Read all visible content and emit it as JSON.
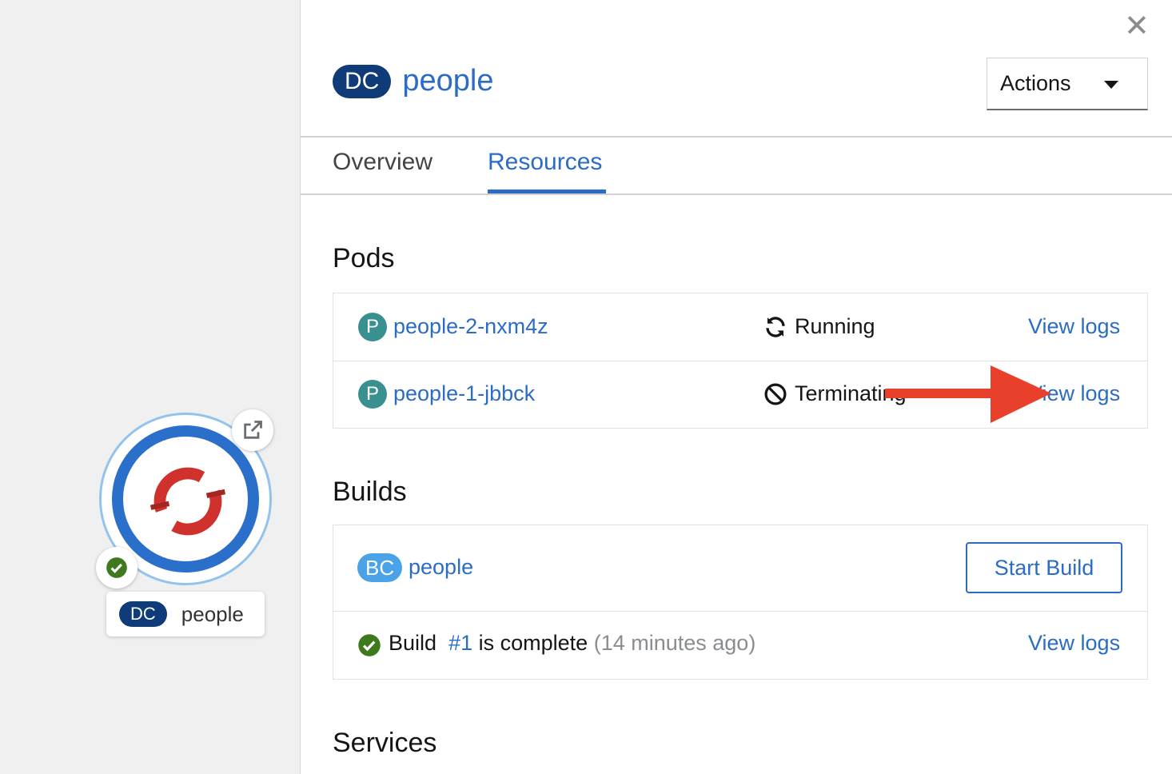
{
  "topology": {
    "node_badge": "DC",
    "node_name": "people"
  },
  "panel": {
    "close_label": "✕",
    "badge": "DC",
    "name": "people",
    "actions_label": "Actions",
    "tabs": [
      {
        "label": "Overview",
        "active": false
      },
      {
        "label": "Resources",
        "active": true
      }
    ]
  },
  "pods": {
    "title": "Pods",
    "items": [
      {
        "icon": "P",
        "name": "people-2-nxm4z",
        "status": "Running",
        "status_icon": "sync-icon",
        "logs": "View logs"
      },
      {
        "icon": "P",
        "name": "people-1-jbbck",
        "status": "Terminating",
        "status_icon": "ban-icon",
        "logs": "View logs"
      }
    ]
  },
  "builds": {
    "title": "Builds",
    "config_badge": "BC",
    "config_name": "people",
    "start_build": "Start Build",
    "build_prefix": "Build",
    "build_number": "#1",
    "build_status": "is complete",
    "build_time": "(14 minutes ago)",
    "logs": "View logs"
  },
  "services": {
    "title": "Services"
  },
  "colors": {
    "link": "#2b6cc4",
    "badge_dc": "#0f3b78",
    "badge_bc": "#4aa3e8",
    "pod_icon": "#3a9090",
    "success": "#3e8635",
    "arrow": "#e8402b"
  }
}
